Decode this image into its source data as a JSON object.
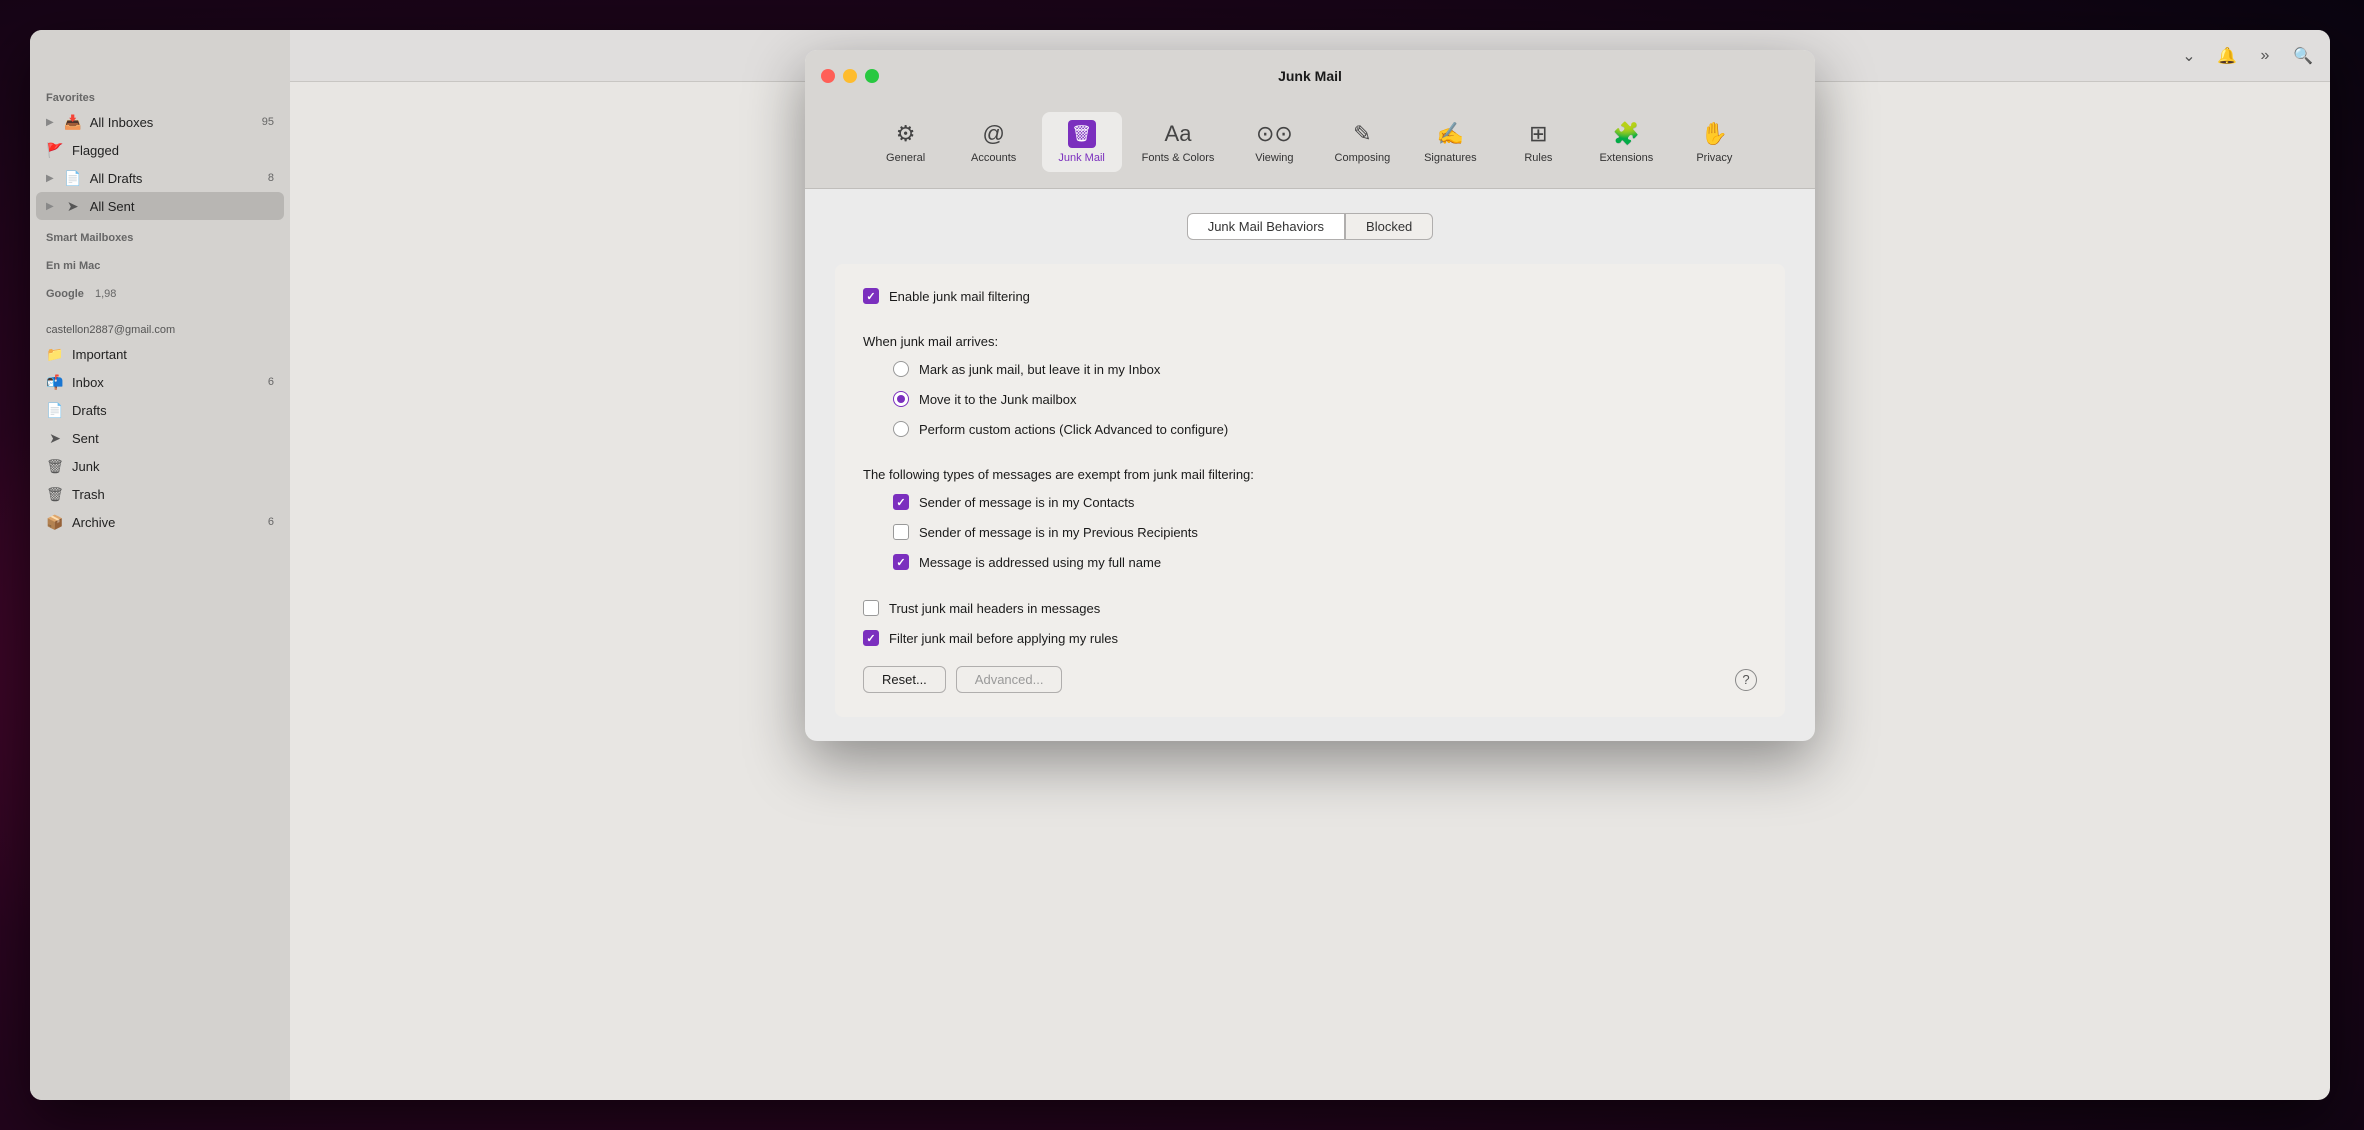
{
  "window": {
    "title": "Junk Mail"
  },
  "sidebar": {
    "favorites_label": "Favorites",
    "all_inboxes": "All Inboxes",
    "all_inboxes_badge": "95",
    "flagged": "Flagged",
    "all_drafts": "All Drafts",
    "all_drafts_badge": "8",
    "all_sent": "All Sent",
    "smart_mailboxes_label": "Smart Mailboxes",
    "en_mi_mac_label": "En mi Mac",
    "google_label": "Google",
    "google_badge": "1,98",
    "account_label": "castellon2887@gmail.com",
    "important": "Important",
    "inbox": "Inbox",
    "inbox_badge": "6",
    "drafts": "Drafts",
    "sent": "Sent",
    "junk": "Junk",
    "trash": "Trash",
    "archive": "Archive",
    "archive_badge": "6"
  },
  "prefs": {
    "title": "Junk Mail",
    "tabs": [
      {
        "id": "general",
        "label": "General",
        "icon": "⚙"
      },
      {
        "id": "accounts",
        "label": "Accounts",
        "icon": "@"
      },
      {
        "id": "junk-mail",
        "label": "Junk Mail",
        "icon": "🗑",
        "active": true
      },
      {
        "id": "fonts-colors",
        "label": "Fonts & Colors",
        "icon": "Aa"
      },
      {
        "id": "viewing",
        "label": "Viewing",
        "icon": "👓"
      },
      {
        "id": "composing",
        "label": "Composing",
        "icon": "✎"
      },
      {
        "id": "signatures",
        "label": "Signatures",
        "icon": "✍"
      },
      {
        "id": "rules",
        "label": "Rules",
        "icon": "🗂"
      },
      {
        "id": "extensions",
        "label": "Extensions",
        "icon": "🧩"
      },
      {
        "id": "privacy",
        "label": "Privacy",
        "icon": "✋"
      }
    ],
    "segments": [
      {
        "id": "behaviors",
        "label": "Junk Mail Behaviors",
        "active": true
      },
      {
        "id": "blocked",
        "label": "Blocked",
        "active": false
      }
    ],
    "enable_filtering": {
      "label": "Enable junk mail filtering",
      "checked": true
    },
    "when_arrives_label": "When junk mail arrives:",
    "radio_options": [
      {
        "id": "mark",
        "label": "Mark as junk mail, but leave it in my Inbox",
        "checked": false
      },
      {
        "id": "move",
        "label": "Move it to the Junk mailbox",
        "checked": true
      },
      {
        "id": "custom",
        "label": "Perform custom actions (Click Advanced to configure)",
        "checked": false
      }
    ],
    "exempt_label": "The following types of messages are exempt from junk mail filtering:",
    "exempt_options": [
      {
        "id": "contacts",
        "label": "Sender of message is in my Contacts",
        "checked": true
      },
      {
        "id": "previous",
        "label": "Sender of message is in my Previous Recipients",
        "checked": false
      },
      {
        "id": "fullname",
        "label": "Message is addressed using my full name",
        "checked": true
      }
    ],
    "trust_headers": {
      "label": "Trust junk mail headers in messages",
      "checked": false
    },
    "filter_before_rules": {
      "label": "Filter junk mail before applying my rules",
      "checked": true
    },
    "buttons": {
      "reset": "Reset...",
      "advanced": "Advanced...",
      "help": "?"
    }
  }
}
